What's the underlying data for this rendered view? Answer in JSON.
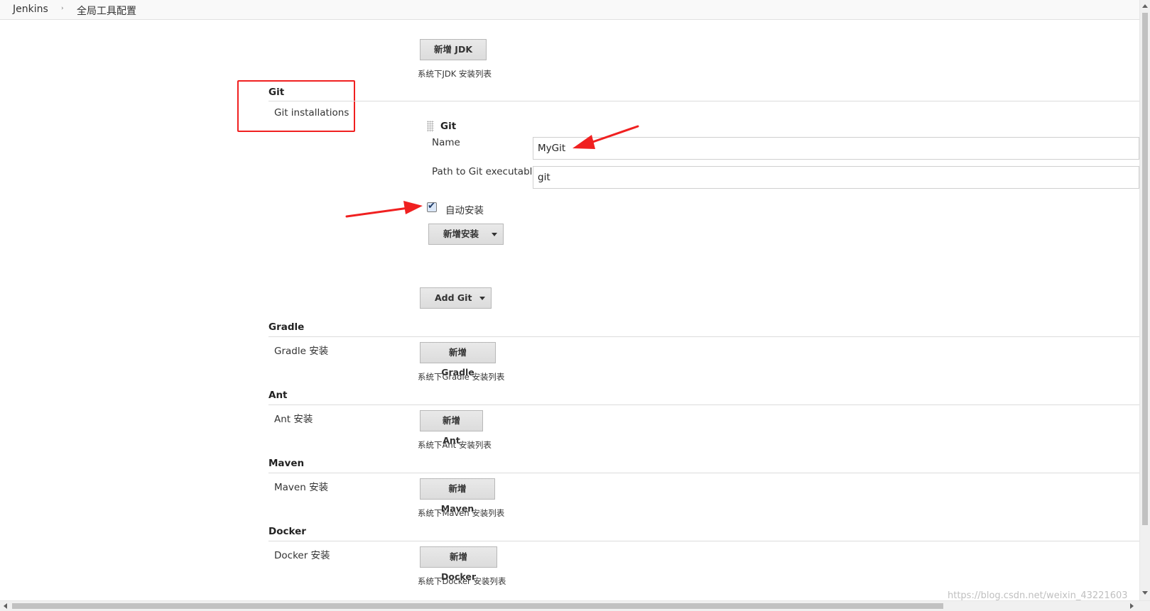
{
  "breadcrumb": {
    "root": "Jenkins",
    "separator": "›",
    "current": "全局工具配置"
  },
  "jdk": {
    "add_button": "新增 JDK",
    "list_description": "系统下JDK 安装列表"
  },
  "git": {
    "section_title": "Git",
    "installations_label": "Git installations",
    "entry": {
      "title": "Git",
      "name_label": "Name",
      "name_value": "MyGit",
      "path_label": "Path to Git executable",
      "path_value": "git",
      "auto_install_label": "自动安装",
      "auto_install_checked": true,
      "add_installer_button": "新增安装"
    },
    "add_button": "Add Git"
  },
  "gradle": {
    "section_title": "Gradle",
    "installations_label": "Gradle 安装",
    "add_button": "新增 Gradle",
    "list_description": "系统下Gradle 安装列表"
  },
  "ant": {
    "section_title": "Ant",
    "installations_label": "Ant 安装",
    "add_button": "新增 Ant",
    "list_description": "系统下Ant 安装列表"
  },
  "maven": {
    "section_title": "Maven",
    "installations_label": "Maven 安装",
    "add_button": "新增 Maven",
    "list_description": "系统下Maven 安装列表"
  },
  "docker": {
    "section_title": "Docker",
    "installations_label": "Docker 安装",
    "add_button": "新增 Docker",
    "list_description": "系统下Docker 安装列表"
  },
  "watermark": "https://blog.csdn.net/weixin_43221603",
  "colors": {
    "annotation_red": "#f02020"
  }
}
